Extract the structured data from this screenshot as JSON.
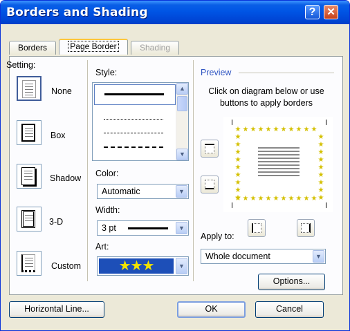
{
  "window": {
    "title": "Borders and Shading"
  },
  "tabs": [
    {
      "label": "Borders",
      "mnemonic": "B"
    },
    {
      "label": "Page Border",
      "mnemonic": "P"
    },
    {
      "label": "Shading"
    }
  ],
  "setting": {
    "label": "Setting:",
    "items": [
      {
        "label": "None"
      },
      {
        "label": "Box"
      },
      {
        "label": "Shadow"
      },
      {
        "label": "3-D"
      },
      {
        "label": "Custom"
      }
    ]
  },
  "style": {
    "label": "Style:"
  },
  "color": {
    "label": "Color:",
    "value": "Automatic"
  },
  "width": {
    "label": "Width:",
    "value": "3 pt"
  },
  "art": {
    "label": "Art:"
  },
  "preview": {
    "label": "Preview",
    "instruction": "Click on diagram below or use buttons to apply borders"
  },
  "apply_to": {
    "label": "Apply to:",
    "value": "Whole document"
  },
  "buttons": {
    "options": "Options...",
    "horizontal_line": "Horizontal Line...",
    "ok": "OK",
    "cancel": "Cancel"
  },
  "icons": {
    "help": "?",
    "close": "✕",
    "scroll_up": "▲",
    "scroll_down": "▼",
    "dropdown": "▼"
  },
  "colors": {
    "titlebar": "#0055e5",
    "dialog_bg": "#ece9d8",
    "accent_tab": "#ffc73c",
    "art_star": "#d4c000",
    "art_bg": "#1d4fb8"
  }
}
